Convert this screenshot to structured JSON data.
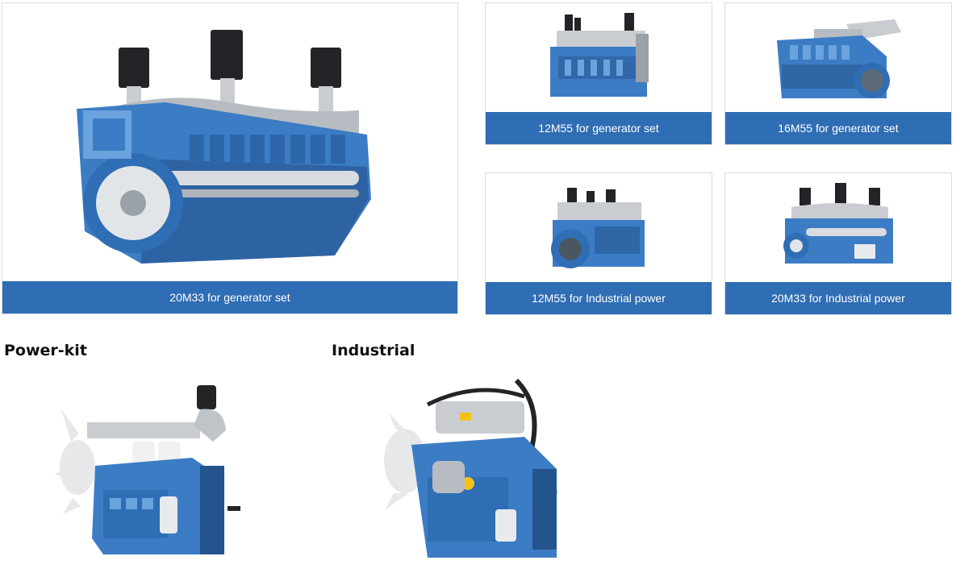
{
  "theme": {
    "label_bg": "#2f6db4",
    "engine_blue": "#3c7cc4",
    "engine_blue_dark": "#24548e",
    "engine_blue_light": "#6aa3dd",
    "chrome": "#c9cdd2",
    "filter_black": "#222428"
  },
  "products": [
    {
      "label": "20M33 for generator set",
      "icon": "engine-20m33-image"
    },
    {
      "label": "12M55 for generator set",
      "icon": "engine-12m55-image"
    },
    {
      "label": "16M55 for generator set",
      "icon": "engine-16m55-image"
    },
    {
      "label": "12M55 for Industrial power",
      "icon": "engine-12m55-industrial-image"
    },
    {
      "label": "20M33 for Industrial power",
      "icon": "engine-20m33-industrial-image"
    }
  ],
  "sections": {
    "powerkit": {
      "title": "Power-kit",
      "icon": "powerkit-engine-image"
    },
    "industrial": {
      "title": "Industrial",
      "icon": "industrial-engine-image"
    }
  }
}
